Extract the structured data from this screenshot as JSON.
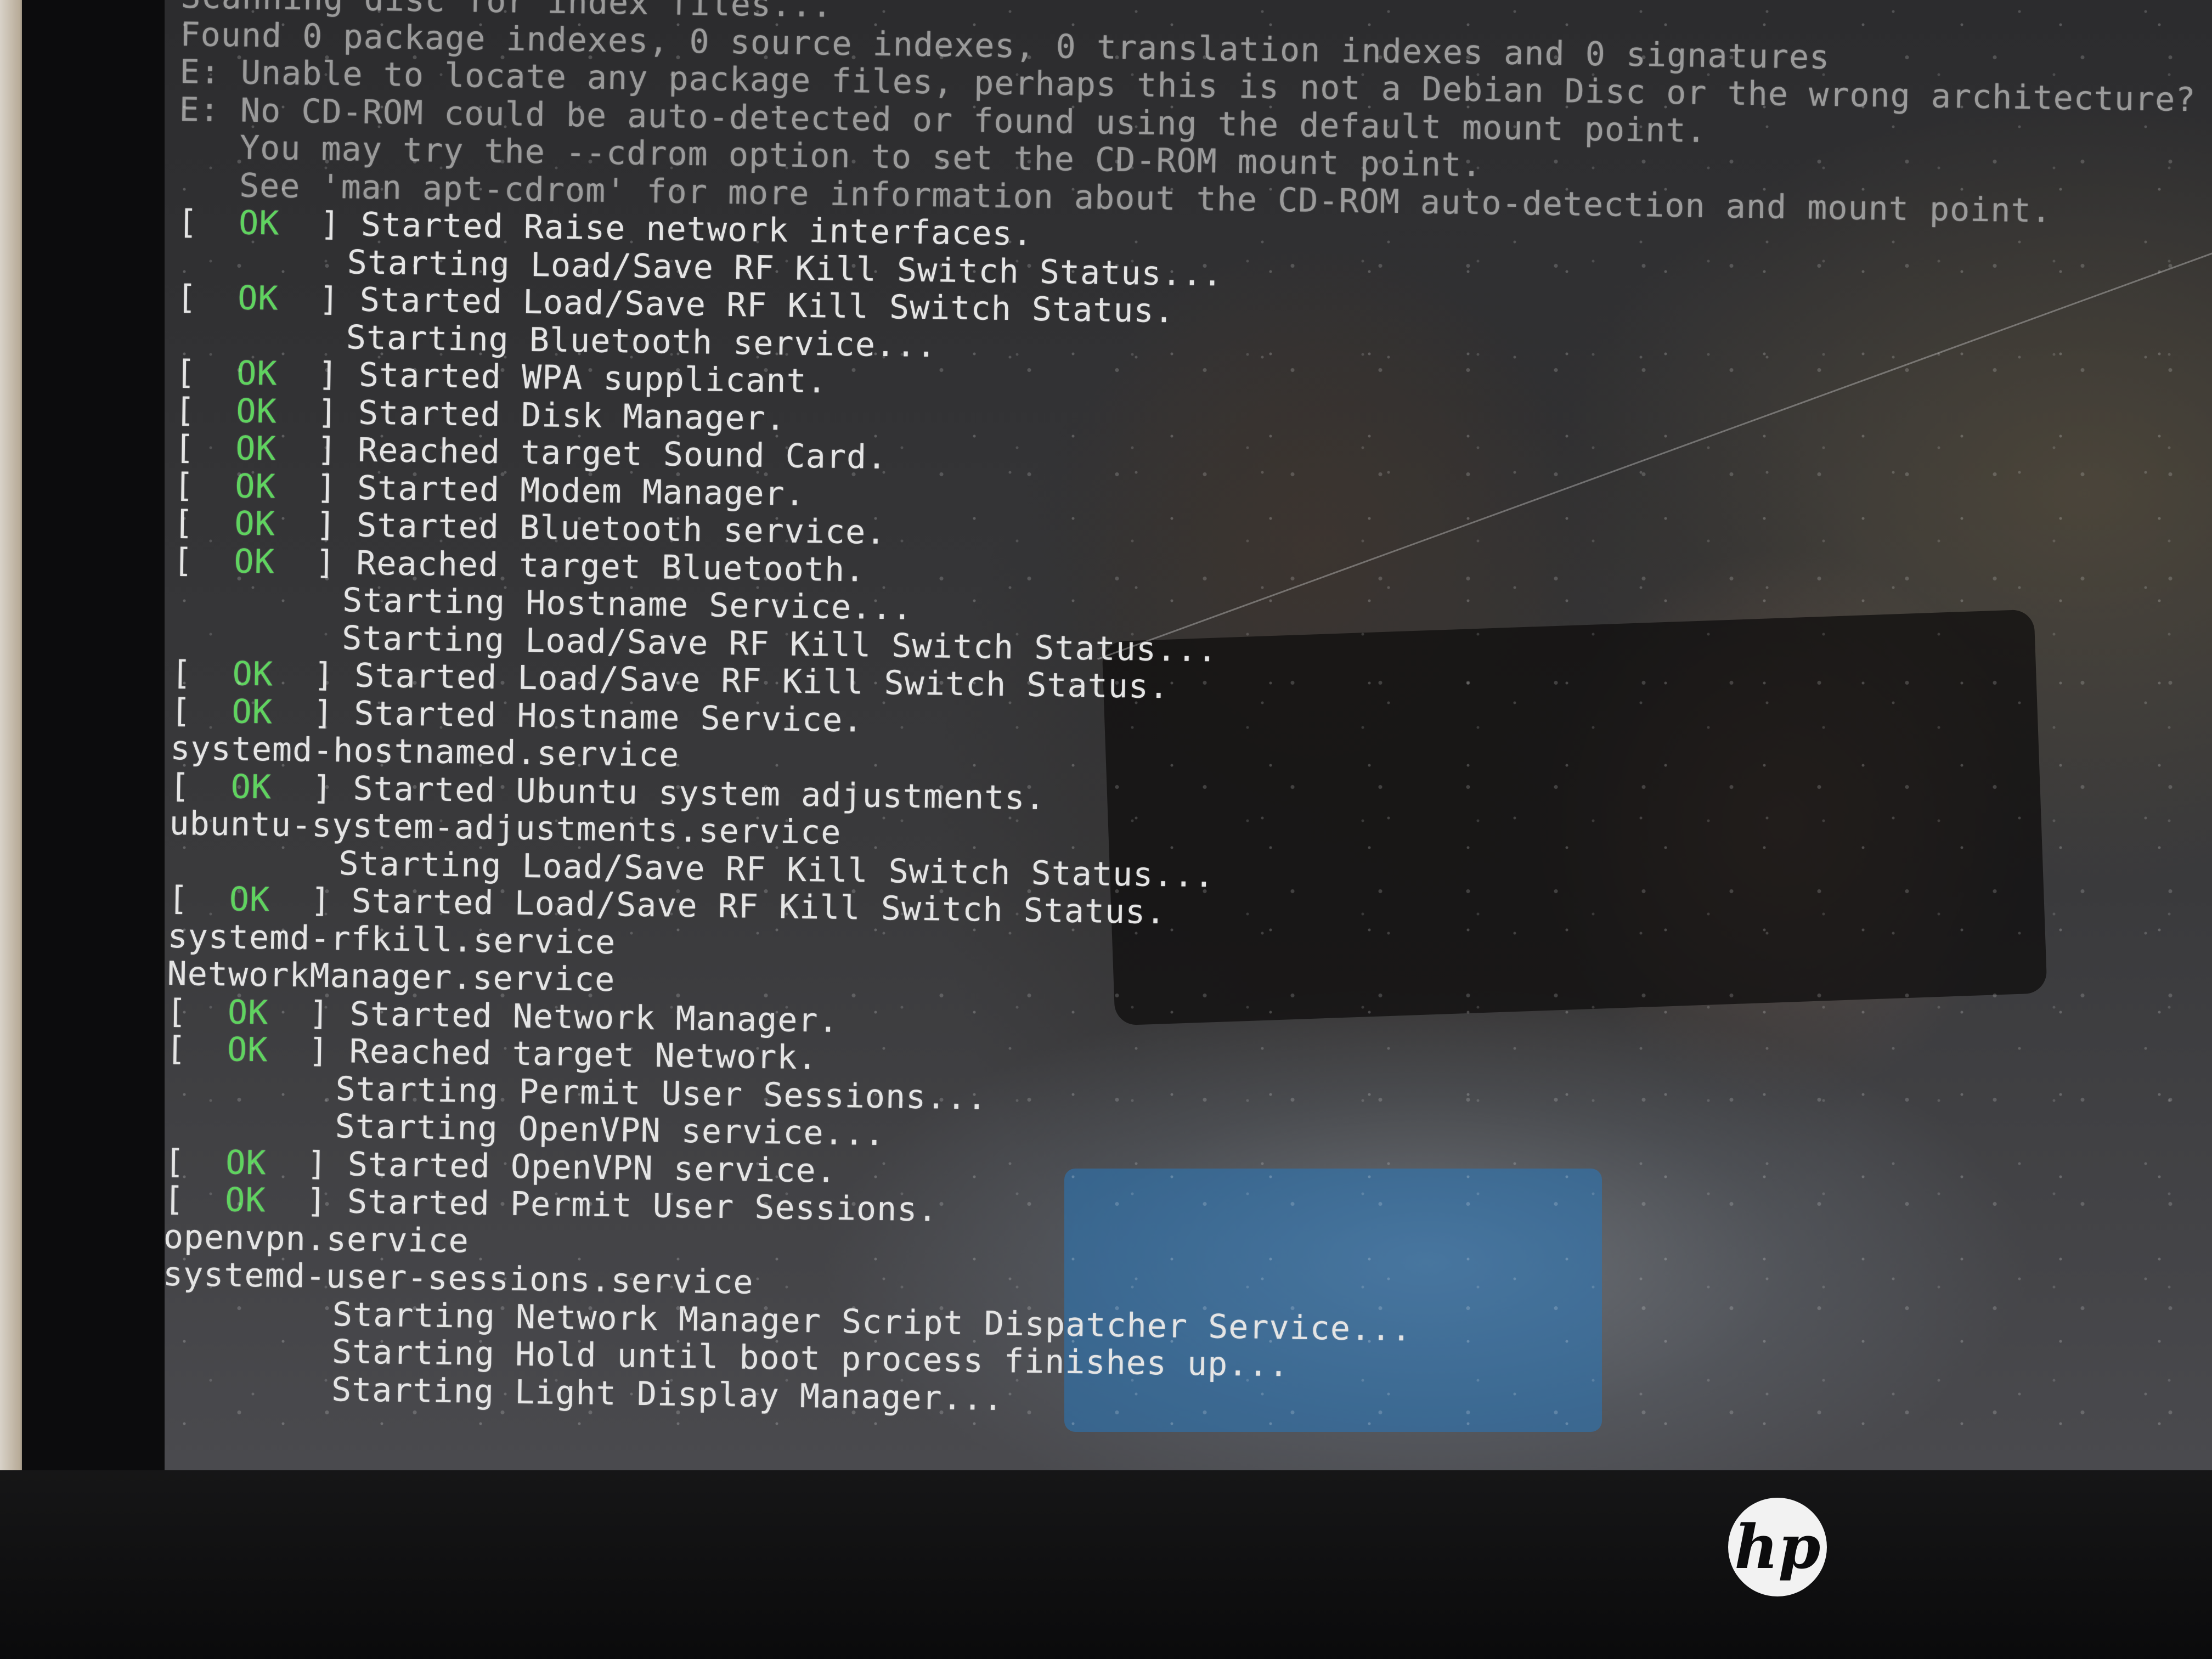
{
  "terminal": {
    "lines": [
      {
        "kind": "plain",
        "cls": "faint",
        "text": "Scanning disc for index files..."
      },
      {
        "kind": "plain",
        "cls": "faint",
        "text": "Found 0 package indexes, 0 source indexes, 0 translation indexes and 0 signatures"
      },
      {
        "kind": "plain",
        "cls": "faint",
        "text": "E: Unable to locate any package files, perhaps this is not a Debian Disc or the wrong architecture?"
      },
      {
        "kind": "plain",
        "cls": "faint",
        "text": "E: No CD-ROM could be auto-detected or found using the default mount point."
      },
      {
        "kind": "plain",
        "cls": "faint",
        "text": "   You may try the --cdrom option to set the CD-ROM mount point."
      },
      {
        "kind": "plain",
        "cls": "faint",
        "text": "   See 'man apt-cdrom' for more information about the CD-ROM auto-detection and mount point."
      },
      {
        "kind": "ok",
        "text": "Started Raise network interfaces."
      },
      {
        "kind": "indent",
        "text": "Starting Load/Save RF Kill Switch Status..."
      },
      {
        "kind": "ok",
        "text": "Started Load/Save RF Kill Switch Status."
      },
      {
        "kind": "indent",
        "text": "Starting Bluetooth service..."
      },
      {
        "kind": "ok",
        "text": "Started WPA supplicant."
      },
      {
        "kind": "ok",
        "text": "Started Disk Manager."
      },
      {
        "kind": "ok",
        "text": "Reached target Sound Card."
      },
      {
        "kind": "ok",
        "text": "Started Modem Manager."
      },
      {
        "kind": "ok",
        "text": "Started Bluetooth service."
      },
      {
        "kind": "ok",
        "text": "Reached target Bluetooth."
      },
      {
        "kind": "indent",
        "text": "Starting Hostname Service..."
      },
      {
        "kind": "indent",
        "text": "Starting Load/Save RF Kill Switch Status..."
      },
      {
        "kind": "ok",
        "text": "Started Load/Save RF Kill Switch Status."
      },
      {
        "kind": "ok",
        "text": "Started Hostname Service."
      },
      {
        "kind": "plain",
        "text": "systemd-hostnamed.service"
      },
      {
        "kind": "ok",
        "text": "Started Ubuntu system adjustments."
      },
      {
        "kind": "plain",
        "text": "ubuntu-system-adjustments.service"
      },
      {
        "kind": "indent",
        "text": "Starting Load/Save RF Kill Switch Status..."
      },
      {
        "kind": "ok",
        "text": "Started Load/Save RF Kill Switch Status."
      },
      {
        "kind": "plain",
        "text": "systemd-rfkill.service"
      },
      {
        "kind": "plain",
        "text": "NetworkManager.service"
      },
      {
        "kind": "ok",
        "text": "Started Network Manager."
      },
      {
        "kind": "ok",
        "text": "Reached target Network."
      },
      {
        "kind": "indent",
        "text": "Starting Permit User Sessions..."
      },
      {
        "kind": "indent",
        "text": "Starting OpenVPN service..."
      },
      {
        "kind": "ok",
        "text": "Started OpenVPN service."
      },
      {
        "kind": "ok",
        "text": "Started Permit User Sessions."
      },
      {
        "kind": "plain",
        "text": "openvpn.service"
      },
      {
        "kind": "plain",
        "text": "systemd-user-sessions.service"
      },
      {
        "kind": "indent",
        "text": "Starting Network Manager Script Dispatcher Service..."
      },
      {
        "kind": "indent",
        "text": "Starting Hold until boot process finishes up..."
      },
      {
        "kind": "indent",
        "text": "Starting Light Display Manager..."
      }
    ],
    "ok_label": "OK",
    "ok_color": "#5fd35f",
    "text_color": "#e4e4e4"
  },
  "device": {
    "brand_logo_text": "hp",
    "brand_logo_icon": "hp-logo-icon"
  }
}
